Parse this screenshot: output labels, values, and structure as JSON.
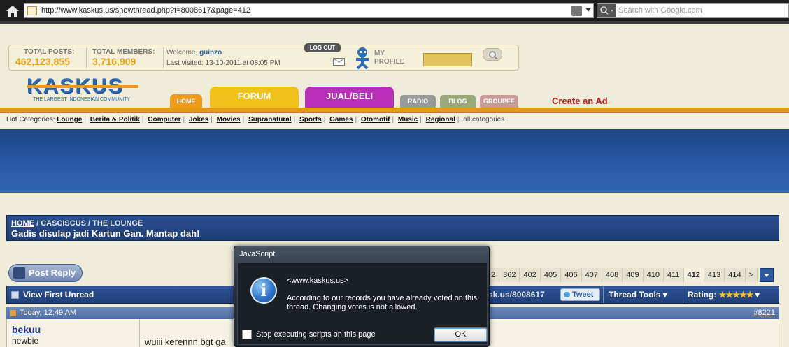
{
  "browser": {
    "url": "http://www.kaskus.us/showthread.php?t=8008617&page=412",
    "search_placeholder": "Search with Google.com"
  },
  "header": {
    "total_posts_label": "TOTAL POSTS:",
    "total_posts_value": "462,123,855",
    "total_members_label": "TOTAL MEMBERS:",
    "total_members_value": "3,716,909",
    "welcome_prefix": "Welcome,",
    "username": "guinzo",
    "last_visited": "Last visited: 13-10-2011 at 08:05 PM",
    "logout_label": "LOG OUT",
    "profile_label_1": "MY",
    "profile_label_2": "PROFILE"
  },
  "logo": {
    "text": "KASKUS",
    "tagline": "THE LARGEST INDONESIAN COMMUNITY"
  },
  "nav": {
    "home": "HOME",
    "forum": "FORUM",
    "jual_beli": "JUAL/BELI",
    "radio": "RADIO",
    "blog": "BLOG",
    "groupee": "GROUPEE",
    "create_ad": "Create an Ad"
  },
  "hot_categories": {
    "label": "Hot Categories:",
    "items": [
      "Lounge",
      "Berita & Politik",
      "Computer",
      "Jokes",
      "Movies",
      "Supranatural",
      "Sports",
      "Games",
      "Otomotif",
      "Music",
      "Regional"
    ],
    "all": "all categories"
  },
  "breadcrumb": {
    "home": "HOME",
    "sep": "/",
    "forum": "CASCISCUS",
    "subforum": "THE LOUNGE",
    "title": "Gadis disulap jadi Kartun Gan. Mantap dah!"
  },
  "post_reply_label": "Post Reply",
  "pagination": {
    "pages": [
      "2",
      "362",
      "402",
      "405",
      "406",
      "407",
      "408",
      "409",
      "410",
      "411",
      "412",
      "413",
      "414",
      ">"
    ],
    "current": "412"
  },
  "thread_bar": {
    "view_first_unread": "View First Unread",
    "short_url": "sk.us/8008617",
    "tweet": "Tweet",
    "thread_tools": "Thread Tools",
    "rating_label": "Rating:",
    "rating_stars": "★★★★★",
    "rating_value": 5
  },
  "post": {
    "date": "Today, 12:49 AM",
    "number": "#8221",
    "username": "bekuu",
    "user_title": "newbie",
    "text": "wuiii kerennn bgt ga"
  },
  "dialog": {
    "title": "JavaScript",
    "origin": "<www.kaskus.us>",
    "message": "According to our records you have already voted on this thread. Changing votes is not allowed.",
    "checkbox_label": "Stop executing scripts on this page",
    "ok_label": "OK"
  }
}
